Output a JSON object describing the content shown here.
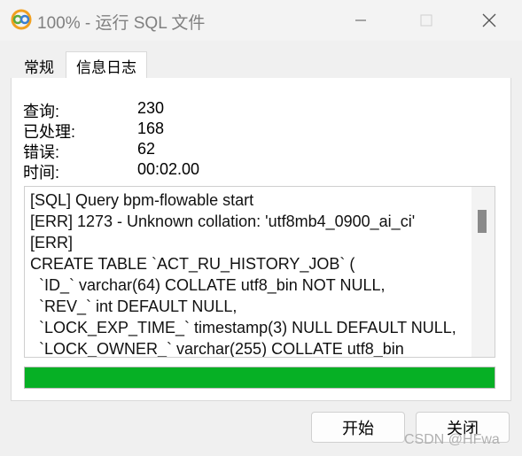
{
  "window": {
    "title": "100% - 运行 SQL 文件",
    "icon": "navicat-icon",
    "controls": [
      "minimize-icon",
      "maximize-icon",
      "close-icon"
    ]
  },
  "tabs": [
    {
      "label": "常规",
      "active": false
    },
    {
      "label": "信息日志",
      "active": true
    }
  ],
  "stats": [
    {
      "label": "查询:",
      "value": "230"
    },
    {
      "label": "已处理:",
      "value": "168"
    },
    {
      "label": "错误:",
      "value": "62"
    },
    {
      "label": "时间:",
      "value": "00:02.00"
    }
  ],
  "log": {
    "lines": [
      "[SQL] Query bpm-flowable start",
      "[ERR] 1273 - Unknown collation: 'utf8mb4_0900_ai_ci'",
      "[ERR]",
      "CREATE TABLE `ACT_RU_HISTORY_JOB` (",
      "  `ID_` varchar(64) COLLATE utf8_bin NOT NULL,",
      "  `REV_` int DEFAULT NULL,",
      "  `LOCK_EXP_TIME_` timestamp(3) NULL DEFAULT NULL,",
      "  `LOCK_OWNER_` varchar(255) COLLATE utf8_bin"
    ]
  },
  "progress": {
    "percent": 100,
    "color": "#06b025"
  },
  "buttons": {
    "start": "开始",
    "close": "关闭"
  },
  "watermark": "CSDN @HFwa"
}
